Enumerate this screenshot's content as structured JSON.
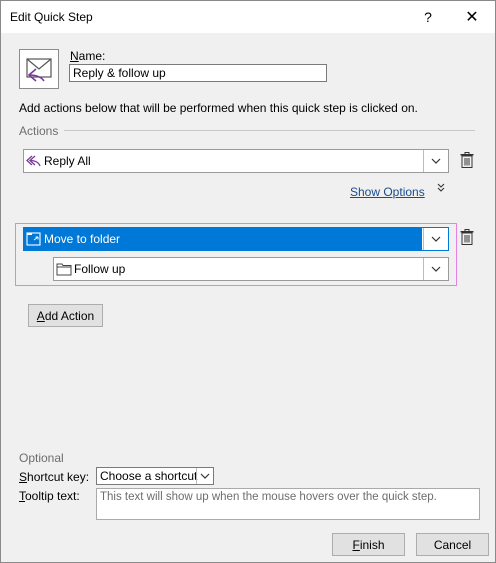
{
  "window": {
    "title": "Edit Quick Step",
    "help_label": "?",
    "close_label": "✕"
  },
  "name": {
    "label_u": "N",
    "label_rest": "ame:",
    "value": "Reply & follow up"
  },
  "description": "Add actions below that will be performed when this quick step is clicked on.",
  "actions": {
    "group_label": "Actions",
    "items": [
      {
        "label": "Reply All",
        "icon": "reply-all-icon"
      },
      {
        "label": "Move to folder",
        "icon": "move-folder-icon",
        "selected": true
      }
    ],
    "show_options": "Show Options",
    "folder_value": "Follow up",
    "add_action_u": "A",
    "add_action_rest": "dd Action"
  },
  "optional": {
    "group_label": "Optional",
    "shortcut_label_u": "S",
    "shortcut_label_rest": "hortcut key:",
    "shortcut_value": "Choose a shortcut",
    "tooltip_label_u": "T",
    "tooltip_label_rest": "ooltip text:",
    "tooltip_placeholder": "This text will show up when the mouse hovers over the quick step."
  },
  "buttons": {
    "finish_u": "F",
    "finish_rest": "inish",
    "cancel": "Cancel"
  },
  "colors": {
    "selection": "#0078d7",
    "highlight_border": "#e680e6",
    "link": "#1a4b8c",
    "icon_purple": "#7a3a9a"
  }
}
